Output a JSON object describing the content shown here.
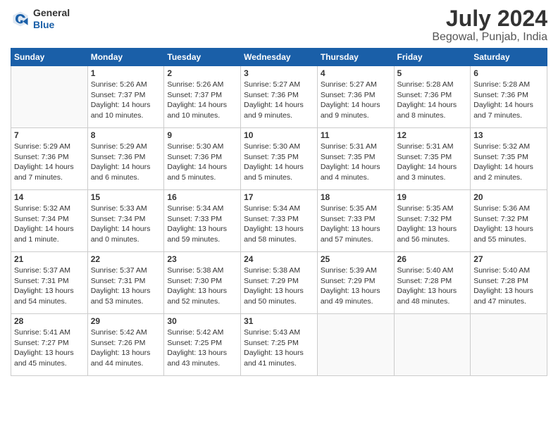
{
  "logo": {
    "line1": "General",
    "line2": "Blue"
  },
  "title": "July 2024",
  "subtitle": "Begowal, Punjab, India",
  "weekdays": [
    "Sunday",
    "Monday",
    "Tuesday",
    "Wednesday",
    "Thursday",
    "Friday",
    "Saturday"
  ],
  "weeks": [
    [
      {
        "day": "",
        "sunrise": "",
        "sunset": "",
        "daylight": ""
      },
      {
        "day": "1",
        "sunrise": "Sunrise: 5:26 AM",
        "sunset": "Sunset: 7:37 PM",
        "daylight": "Daylight: 14 hours and 10 minutes."
      },
      {
        "day": "2",
        "sunrise": "Sunrise: 5:26 AM",
        "sunset": "Sunset: 7:37 PM",
        "daylight": "Daylight: 14 hours and 10 minutes."
      },
      {
        "day": "3",
        "sunrise": "Sunrise: 5:27 AM",
        "sunset": "Sunset: 7:36 PM",
        "daylight": "Daylight: 14 hours and 9 minutes."
      },
      {
        "day": "4",
        "sunrise": "Sunrise: 5:27 AM",
        "sunset": "Sunset: 7:36 PM",
        "daylight": "Daylight: 14 hours and 9 minutes."
      },
      {
        "day": "5",
        "sunrise": "Sunrise: 5:28 AM",
        "sunset": "Sunset: 7:36 PM",
        "daylight": "Daylight: 14 hours and 8 minutes."
      },
      {
        "day": "6",
        "sunrise": "Sunrise: 5:28 AM",
        "sunset": "Sunset: 7:36 PM",
        "daylight": "Daylight: 14 hours and 7 minutes."
      }
    ],
    [
      {
        "day": "7",
        "sunrise": "Sunrise: 5:29 AM",
        "sunset": "Sunset: 7:36 PM",
        "daylight": "Daylight: 14 hours and 7 minutes."
      },
      {
        "day": "8",
        "sunrise": "Sunrise: 5:29 AM",
        "sunset": "Sunset: 7:36 PM",
        "daylight": "Daylight: 14 hours and 6 minutes."
      },
      {
        "day": "9",
        "sunrise": "Sunrise: 5:30 AM",
        "sunset": "Sunset: 7:36 PM",
        "daylight": "Daylight: 14 hours and 5 minutes."
      },
      {
        "day": "10",
        "sunrise": "Sunrise: 5:30 AM",
        "sunset": "Sunset: 7:35 PM",
        "daylight": "Daylight: 14 hours and 5 minutes."
      },
      {
        "day": "11",
        "sunrise": "Sunrise: 5:31 AM",
        "sunset": "Sunset: 7:35 PM",
        "daylight": "Daylight: 14 hours and 4 minutes."
      },
      {
        "day": "12",
        "sunrise": "Sunrise: 5:31 AM",
        "sunset": "Sunset: 7:35 PM",
        "daylight": "Daylight: 14 hours and 3 minutes."
      },
      {
        "day": "13",
        "sunrise": "Sunrise: 5:32 AM",
        "sunset": "Sunset: 7:35 PM",
        "daylight": "Daylight: 14 hours and 2 minutes."
      }
    ],
    [
      {
        "day": "14",
        "sunrise": "Sunrise: 5:32 AM",
        "sunset": "Sunset: 7:34 PM",
        "daylight": "Daylight: 14 hours and 1 minute."
      },
      {
        "day": "15",
        "sunrise": "Sunrise: 5:33 AM",
        "sunset": "Sunset: 7:34 PM",
        "daylight": "Daylight: 14 hours and 0 minutes."
      },
      {
        "day": "16",
        "sunrise": "Sunrise: 5:34 AM",
        "sunset": "Sunset: 7:33 PM",
        "daylight": "Daylight: 13 hours and 59 minutes."
      },
      {
        "day": "17",
        "sunrise": "Sunrise: 5:34 AM",
        "sunset": "Sunset: 7:33 PM",
        "daylight": "Daylight: 13 hours and 58 minutes."
      },
      {
        "day": "18",
        "sunrise": "Sunrise: 5:35 AM",
        "sunset": "Sunset: 7:33 PM",
        "daylight": "Daylight: 13 hours and 57 minutes."
      },
      {
        "day": "19",
        "sunrise": "Sunrise: 5:35 AM",
        "sunset": "Sunset: 7:32 PM",
        "daylight": "Daylight: 13 hours and 56 minutes."
      },
      {
        "day": "20",
        "sunrise": "Sunrise: 5:36 AM",
        "sunset": "Sunset: 7:32 PM",
        "daylight": "Daylight: 13 hours and 55 minutes."
      }
    ],
    [
      {
        "day": "21",
        "sunrise": "Sunrise: 5:37 AM",
        "sunset": "Sunset: 7:31 PM",
        "daylight": "Daylight: 13 hours and 54 minutes."
      },
      {
        "day": "22",
        "sunrise": "Sunrise: 5:37 AM",
        "sunset": "Sunset: 7:31 PM",
        "daylight": "Daylight: 13 hours and 53 minutes."
      },
      {
        "day": "23",
        "sunrise": "Sunrise: 5:38 AM",
        "sunset": "Sunset: 7:30 PM",
        "daylight": "Daylight: 13 hours and 52 minutes."
      },
      {
        "day": "24",
        "sunrise": "Sunrise: 5:38 AM",
        "sunset": "Sunset: 7:29 PM",
        "daylight": "Daylight: 13 hours and 50 minutes."
      },
      {
        "day": "25",
        "sunrise": "Sunrise: 5:39 AM",
        "sunset": "Sunset: 7:29 PM",
        "daylight": "Daylight: 13 hours and 49 minutes."
      },
      {
        "day": "26",
        "sunrise": "Sunrise: 5:40 AM",
        "sunset": "Sunset: 7:28 PM",
        "daylight": "Daylight: 13 hours and 48 minutes."
      },
      {
        "day": "27",
        "sunrise": "Sunrise: 5:40 AM",
        "sunset": "Sunset: 7:28 PM",
        "daylight": "Daylight: 13 hours and 47 minutes."
      }
    ],
    [
      {
        "day": "28",
        "sunrise": "Sunrise: 5:41 AM",
        "sunset": "Sunset: 7:27 PM",
        "daylight": "Daylight: 13 hours and 45 minutes."
      },
      {
        "day": "29",
        "sunrise": "Sunrise: 5:42 AM",
        "sunset": "Sunset: 7:26 PM",
        "daylight": "Daylight: 13 hours and 44 minutes."
      },
      {
        "day": "30",
        "sunrise": "Sunrise: 5:42 AM",
        "sunset": "Sunset: 7:25 PM",
        "daylight": "Daylight: 13 hours and 43 minutes."
      },
      {
        "day": "31",
        "sunrise": "Sunrise: 5:43 AM",
        "sunset": "Sunset: 7:25 PM",
        "daylight": "Daylight: 13 hours and 41 minutes."
      },
      {
        "day": "",
        "sunrise": "",
        "sunset": "",
        "daylight": ""
      },
      {
        "day": "",
        "sunrise": "",
        "sunset": "",
        "daylight": ""
      },
      {
        "day": "",
        "sunrise": "",
        "sunset": "",
        "daylight": ""
      }
    ]
  ]
}
